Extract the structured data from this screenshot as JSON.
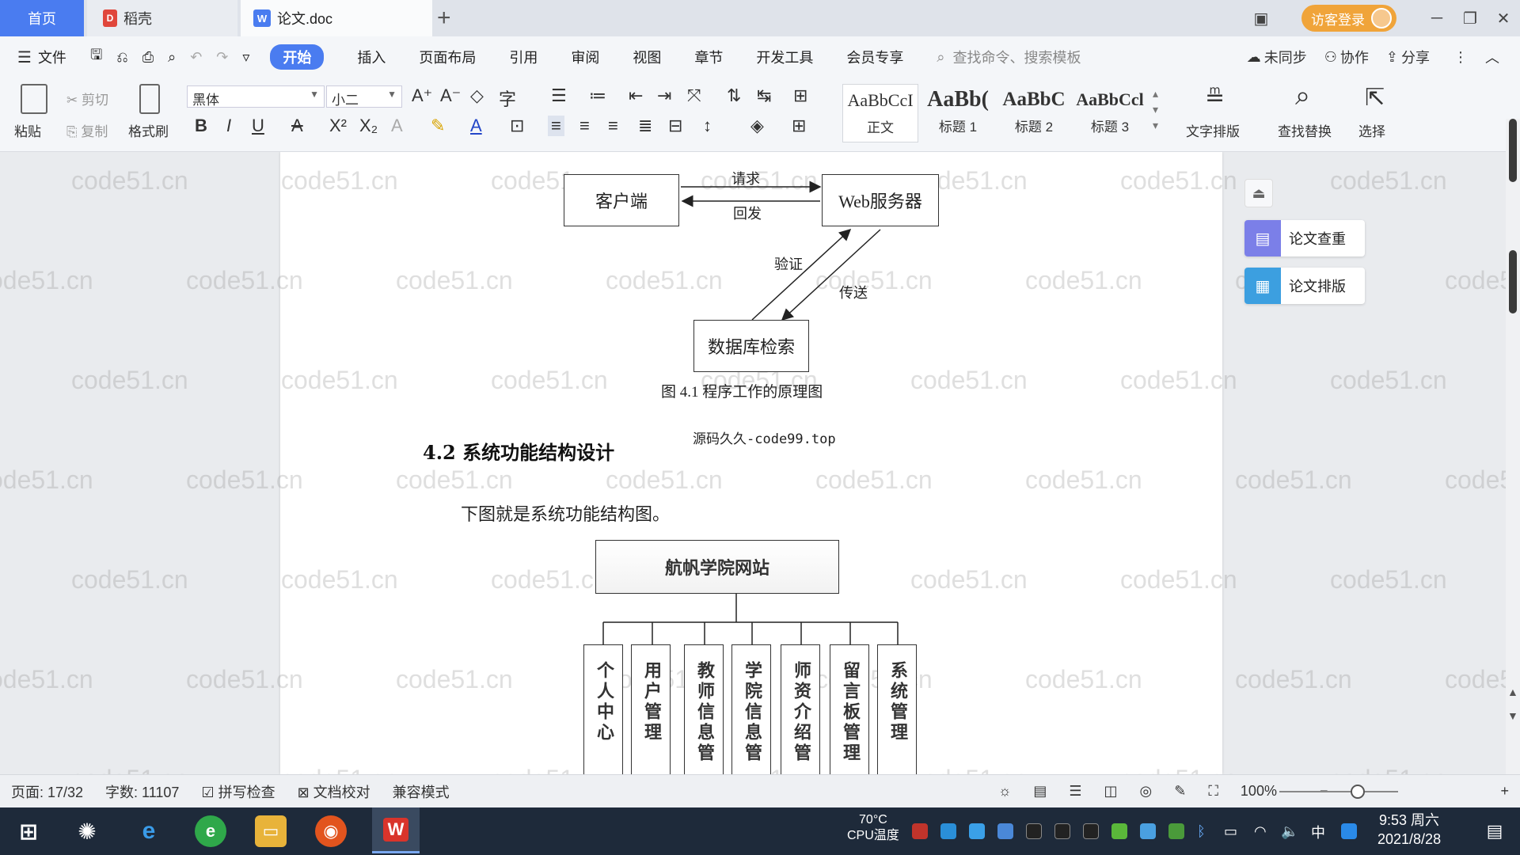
{
  "titlebar": {
    "tab_home": "首页",
    "tab_daoke": "稻壳",
    "tab_doc": "论文.doc",
    "add_tab": "+",
    "login": "访客登录"
  },
  "menubar": {
    "file": "文件",
    "items": [
      "开始",
      "插入",
      "页面布局",
      "引用",
      "审阅",
      "视图",
      "章节",
      "开发工具",
      "会员专享"
    ],
    "search_placeholder": "查找命令、搜索模板",
    "unsync": "未同步",
    "collab": "协作",
    "share": "分享"
  },
  "ribbon": {
    "paste": "粘贴",
    "cut": "剪切",
    "copy": "复制",
    "format_painter": "格式刷",
    "font_name": "黑体",
    "font_size": "小二",
    "styles": [
      {
        "preview": "AaBbCcI",
        "name": "正文"
      },
      {
        "preview": "AaBb(",
        "name": "标题 1"
      },
      {
        "preview": "AaBbC",
        "name": "标题 2"
      },
      {
        "preview": "AaBbCcl",
        "name": "标题 3"
      }
    ],
    "text_layout": "文字排版",
    "find_replace": "查找替换",
    "select": "选择"
  },
  "document": {
    "watermark": "code51.cn",
    "fig1": {
      "client": "客户端",
      "web_server": "Web服务器",
      "request": "请求",
      "reply": "回发",
      "verify": "验证",
      "send": "传送",
      "db": "数据库检索",
      "caption": "图 4.1  程序工作的原理图"
    },
    "code_note": "源码久久-code99.top",
    "heading": "4.2 系统功能结构设计",
    "body": "下图就是系统功能结构图。",
    "fig2": {
      "root": "航帆学院网站",
      "children": [
        "个人中心",
        "用户管理",
        "教师信息管",
        "学院信息管",
        "师资介绍管",
        "留言板管理",
        "系统管理"
      ]
    }
  },
  "sidepanel": {
    "check": "论文查重",
    "layout": "论文排版"
  },
  "statusbar": {
    "page": "页面: 17/32",
    "words": "字数: 11107",
    "spell": "拼写检查",
    "proof": "文档校对",
    "compat": "兼容模式",
    "zoom": "100%"
  },
  "taskbar": {
    "cpu_temp": "70°C",
    "cpu_label": "CPU温度",
    "ime": "中",
    "time": "9:53 周六",
    "date": "2021/8/28"
  }
}
